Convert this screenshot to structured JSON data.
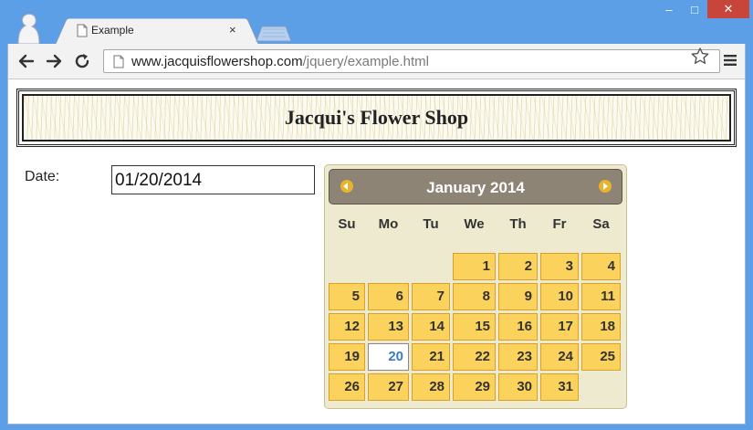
{
  "browser": {
    "tab_title": "Example",
    "tab_close": "×",
    "url_host": "www.jacquisflowershop.com",
    "url_path": "/jquery/example.html",
    "controls": {
      "minimize": "‒",
      "maximize": "□",
      "close": "✕"
    }
  },
  "page": {
    "banner_title": "Jacqui's Flower Shop",
    "date_label": "Date:",
    "date_value": "01/20/2014"
  },
  "datepicker": {
    "title": "January 2014",
    "weekdays": [
      "Su",
      "Mo",
      "Tu",
      "We",
      "Th",
      "Fr",
      "Sa"
    ],
    "days": [
      "1",
      "2",
      "3",
      "4",
      "5",
      "6",
      "7",
      "8",
      "9",
      "10",
      "11",
      "12",
      "13",
      "14",
      "15",
      "16",
      "17",
      "18",
      "19",
      "20",
      "21",
      "22",
      "23",
      "24",
      "25",
      "26",
      "27",
      "28",
      "29",
      "30",
      "31"
    ],
    "selected_day": "20",
    "colors": {
      "header": "#8d8475",
      "day_bg": "#fbd35c",
      "panel_bg": "#eeeacf",
      "selected_text": "#3a7ac8"
    }
  }
}
